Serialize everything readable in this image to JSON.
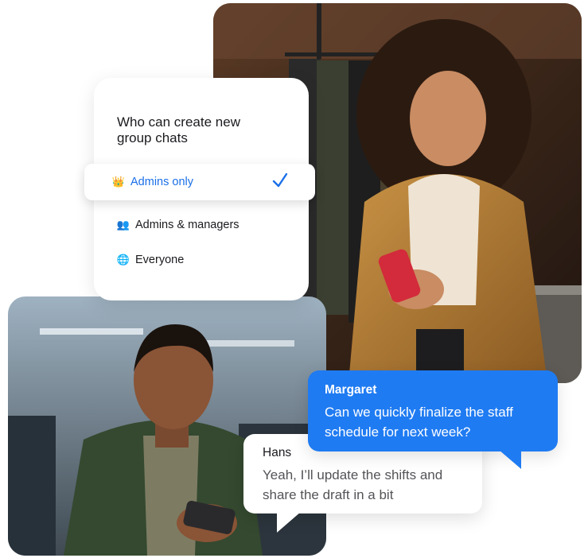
{
  "settings_card": {
    "title": "Who can create new group chats",
    "options": [
      {
        "label": "Admins only",
        "icon": "crown-icon",
        "emoji": "👑",
        "selected": true
      },
      {
        "label": "Admins & managers",
        "icon": "people-icon",
        "emoji": "👥",
        "selected": false
      },
      {
        "label": "Everyone",
        "icon": "globe-icon",
        "emoji": "🌐",
        "selected": false
      }
    ],
    "accent_color": "#1a6fe8"
  },
  "messages": [
    {
      "sender": "Margaret",
      "text": "Can we quickly finalize the staff schedule for next week?",
      "style": "outgoing",
      "color": "#1f7bf2"
    },
    {
      "sender": "Hans",
      "text": "Yeah, I’ll update the shifts and share the draft in a bit",
      "style": "incoming",
      "color": "#ffffff"
    }
  ]
}
